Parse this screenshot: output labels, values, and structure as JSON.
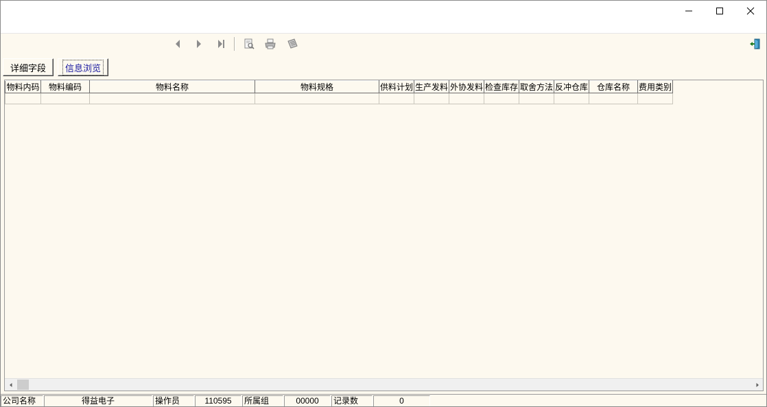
{
  "window": {
    "controls": {
      "minimize_icon": "minimize-icon",
      "maximize_icon": "maximize-icon",
      "close_icon": "close-icon"
    }
  },
  "toolbar": {
    "icons": [
      "prev-record-icon",
      "next-record-icon",
      "last-record-icon",
      "print-preview-icon",
      "print-icon",
      "export-icon",
      "exit-icon"
    ]
  },
  "tabs": [
    {
      "label": "详细字段",
      "active": false
    },
    {
      "label": "信息浏览",
      "active": true
    }
  ],
  "grid": {
    "columns": [
      "物料内码",
      "物料编码",
      "物料名称",
      "物料规格",
      "供料计划",
      "生产发料",
      "外协发料",
      "检查库存",
      "取舍方法",
      "反冲仓库",
      "仓库名称",
      "费用类别"
    ],
    "rows": [
      [
        "",
        "",
        "",
        "",
        "",
        "",
        "",
        "",
        "",
        "",
        "",
        ""
      ]
    ]
  },
  "statusbar": {
    "company_label": "公司名称",
    "company_value": "得益电子",
    "operator_label": "操作员",
    "operator_value": "110595",
    "group_label": "所属组",
    "group_value": "00000",
    "count_label": "记录数",
    "count_value": "0"
  },
  "colors": {
    "background": "#fdf9ef",
    "active_tab_text": "#1a1aa0"
  }
}
